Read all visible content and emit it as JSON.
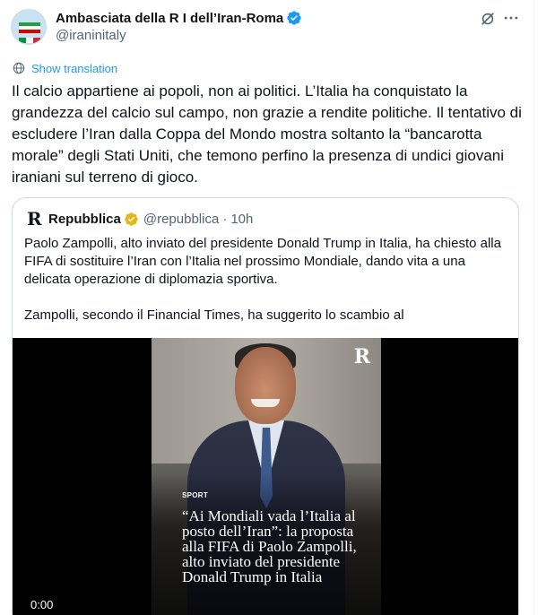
{
  "author": {
    "display_name": "Ambasciata della R I dell’Iran-Roma",
    "handle": "@iraninitaly",
    "icons": {
      "verified": "verified-badge-icon",
      "grok": "grok-icon",
      "more": "more-icon"
    }
  },
  "translation": {
    "label": "Show translation",
    "icon": "globe-icon"
  },
  "tweet": {
    "text": "Il calcio appartiene ai popoli, non ai politici. L’Italia ha conquistato la grandezza del calcio sul campo, non grazie a rendite politiche. Il tentativo di escludere l’Iran dalla Coppa del Mondo mostra soltanto la “bancarotta morale” degli Stati Uniti, che temono perfino la presenza di undici giovani iraniani sul terreno di gioco."
  },
  "quote": {
    "logo": "R",
    "name": "Repubblica",
    "handle": "@repubblica",
    "separator": "·",
    "time": "10h",
    "paragraphs": [
      "Paolo Zampolli, alto inviato del presidente Donald Trump in Italia, ha chiesto alla FIFA di sostituire l’Iran con l’Italia nel prossimo Mondiale, dando vita a una delicata operazione di diplomazia sportiva.",
      "Zampolli, secondo il Financial Times, ha suggerito lo scambio al"
    ],
    "media": {
      "brand_mark": "R",
      "section": "SPORT",
      "headline": "“Ai Mondiali vada l’Italia al posto dell’Iran”: la proposta alla FIFA di Paolo Zampolli, alto inviato del presidente Donald Trump in Italia",
      "video_time": "0:00"
    }
  },
  "colors": {
    "accent": "#1d9bf0",
    "verified_blue": "#1d9bf0",
    "verified_gold": "#e2b719",
    "muted": "#536471"
  }
}
